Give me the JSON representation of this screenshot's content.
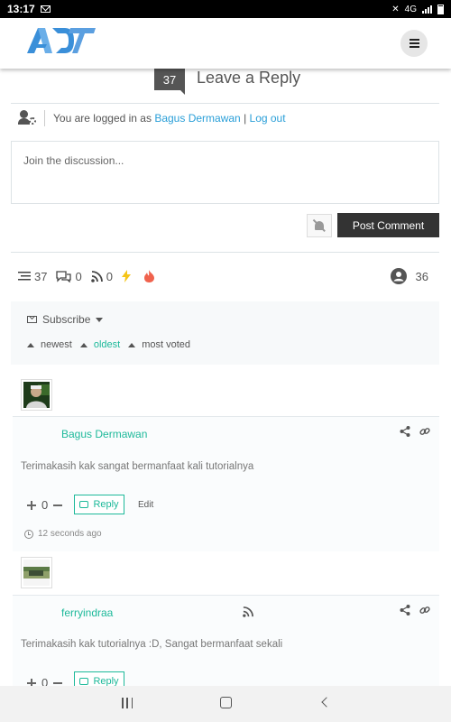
{
  "status_bar": {
    "time": "13:17",
    "network": "4G"
  },
  "header": {
    "logo_alt": "ADT",
    "menu_icon": "hamburger-icon"
  },
  "reply_section": {
    "count": "37",
    "title": "Leave a Reply",
    "logged_in_prefix": "You are logged in as",
    "user": "Bagus Dermawan",
    "separator": "|",
    "logout": "Log out",
    "placeholder": "Join the discussion...",
    "post_button": "Post Comment"
  },
  "stats": {
    "threads": "37",
    "replies": "0",
    "followers": "0",
    "participants": "36"
  },
  "subscribe": {
    "label": "Subscribe"
  },
  "sort": {
    "newest": "newest",
    "oldest": "oldest",
    "most_voted": "most voted"
  },
  "comments": [
    {
      "author": "Bagus Dermawan",
      "text": "Terimakasih kak sangat bermanfaat kali tutorialnya",
      "votes": "0",
      "reply_label": "Reply",
      "edit_label": "Edit",
      "time": "12 seconds ago"
    },
    {
      "author": "ferryindraa",
      "text": "Terimakasih kak tutorialnya :D, Sangat bermanfaat sekali",
      "votes": "0",
      "reply_label": "Reply"
    }
  ],
  "colors": {
    "accent": "#1db99a",
    "link": "#2a9fd8",
    "dark_button": "#333333",
    "logo": "#3a8fd9"
  }
}
